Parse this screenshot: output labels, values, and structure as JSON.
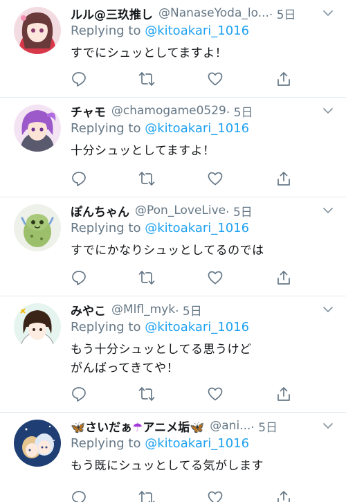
{
  "icons": {
    "reply": "reply-icon",
    "retweet": "retweet-icon",
    "like": "heart-icon",
    "share": "share-icon",
    "more": "chevron-down-icon"
  },
  "colors": {
    "link": "#1da1f2",
    "secondary": "#657786",
    "divider": "#e1e8ed"
  },
  "tweets": [
    {
      "name": "ルル@三玖推し",
      "handle": "@NanaseYoda_lo...",
      "time": "· 5日",
      "reply_prefix": "Replying to ",
      "reply_to": "@kitoakari_1016",
      "lines": [
        "すでにシュッとしてますよ！"
      ]
    },
    {
      "name": "チャモ",
      "handle": "@chamogame0529",
      "time": "· 5日",
      "reply_prefix": "Replying to ",
      "reply_to": "@kitoakari_1016",
      "lines": [
        "十分シュッとしてますよ！"
      ]
    },
    {
      "name": "ぽんちゃん",
      "handle": "@Pon_LoveLive",
      "time": "· 5日",
      "reply_prefix": "Replying to ",
      "reply_to": "@kitoakari_1016",
      "lines": [
        "すでにかなりシュッとしてるのでは"
      ]
    },
    {
      "name": "みやこ",
      "handle": "@Mlfl_myk",
      "time": "· 5日",
      "reply_prefix": "Replying to ",
      "reply_to": "@kitoakari_1016",
      "lines": [
        "もう十分シュッとしてる思うけど",
        "がんばってきてや！"
      ]
    },
    {
      "name_parts": [
        "🦋",
        "さいだぁ",
        "☂",
        "アニメ垢",
        "🦋"
      ],
      "handle": "@ani...",
      "time": "· 5日",
      "reply_prefix": "Replying to ",
      "reply_to": "@kitoakari_1016",
      "lines": [
        "もう既にシュッとしてる気がします"
      ]
    }
  ]
}
